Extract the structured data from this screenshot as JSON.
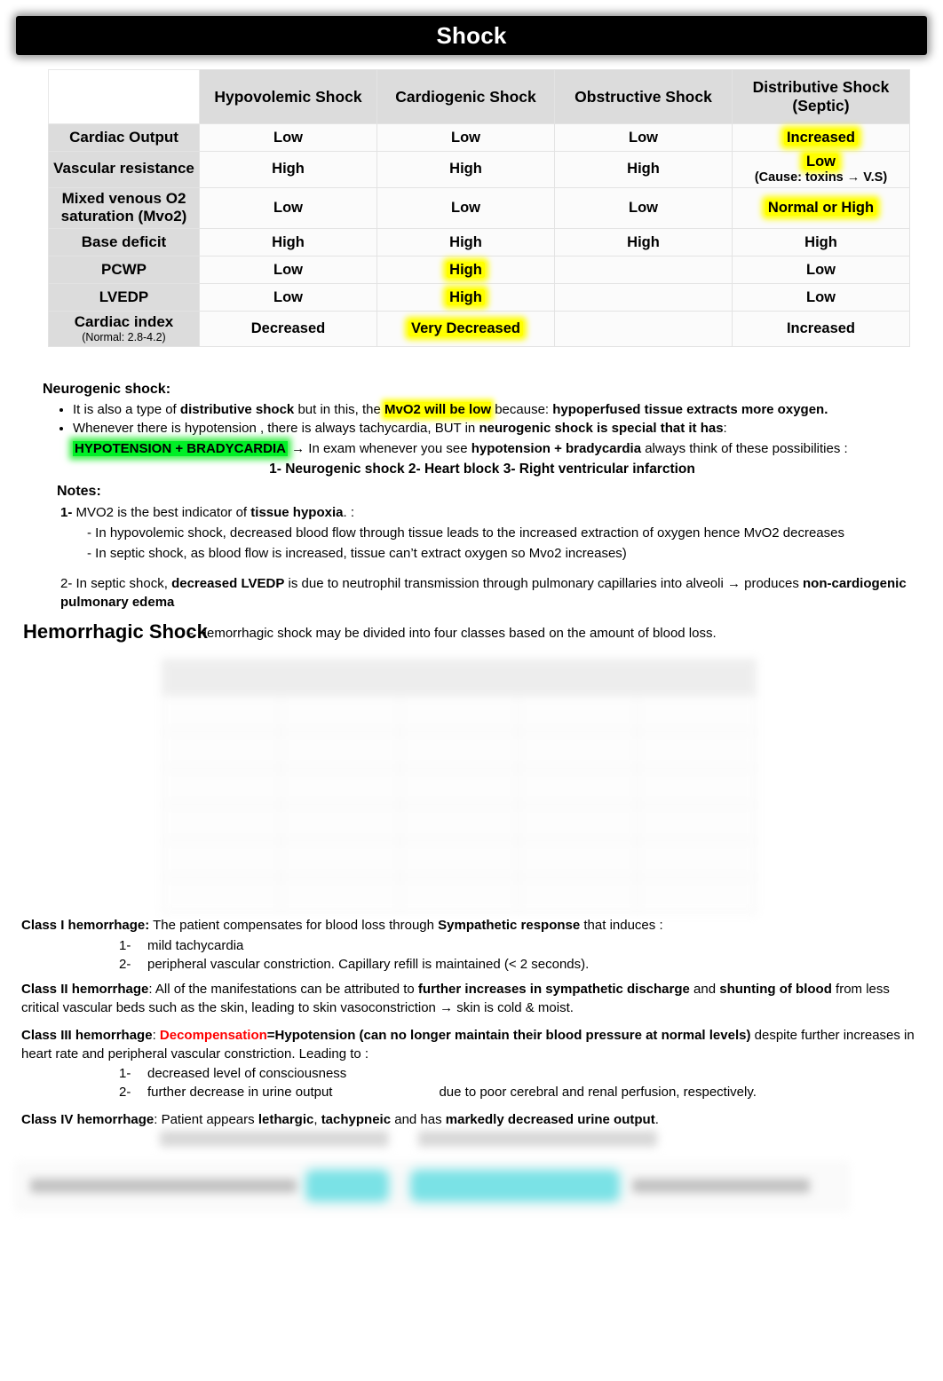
{
  "banner": {
    "title": "Shock"
  },
  "colors": {
    "highlight_yellow": "#ffff00",
    "highlight_green": "#00ef26",
    "highlight_cyan": "#22cfd6",
    "accent_red": "#ff0000",
    "banner_bg": "#000000",
    "row_label_bg": "#dcdcdc"
  },
  "comparison_table": {
    "corner_label": "",
    "columns": [
      "Hypovolemic Shock",
      "Cardiogenic Shock",
      "Obstructive Shock",
      "Distributive Shock (Septic)"
    ],
    "column_lines": [
      [
        "Hypovolemic Shock"
      ],
      [
        "Cardiogenic Shock"
      ],
      [
        "Obstructive Shock"
      ],
      [
        "Distributive Shock",
        "(Septic)"
      ]
    ],
    "rows": [
      {
        "label": "Cardiac Output",
        "label_sub": "",
        "cells": [
          {
            "text": "Low",
            "highlight": "none"
          },
          {
            "text": "Low",
            "highlight": "none"
          },
          {
            "text": "Low",
            "highlight": "none"
          },
          {
            "text": "Increased",
            "highlight": "yellow"
          }
        ]
      },
      {
        "label": "Vascular resistance",
        "label_sub": "",
        "cells": [
          {
            "text": "High",
            "highlight": "none"
          },
          {
            "text": "High",
            "highlight": "none"
          },
          {
            "text": "High",
            "highlight": "none"
          },
          {
            "text": "Low",
            "highlight": "yellow",
            "note": "(Cause: toxins → V.S)"
          }
        ]
      },
      {
        "label": "Mixed venous O2 saturation (Mvo2)",
        "label_sub": "",
        "cells": [
          {
            "text": "Low",
            "highlight": "none"
          },
          {
            "text": "Low",
            "highlight": "none"
          },
          {
            "text": "Low",
            "highlight": "none"
          },
          {
            "text": "Normal or High",
            "highlight": "yellow"
          }
        ]
      },
      {
        "label": "Base deficit",
        "label_sub": "",
        "cells": [
          {
            "text": "High",
            "highlight": "none"
          },
          {
            "text": "High",
            "highlight": "none"
          },
          {
            "text": "High",
            "highlight": "none"
          },
          {
            "text": "High",
            "highlight": "none"
          }
        ]
      },
      {
        "label": "PCWP",
        "label_sub": "",
        "cells": [
          {
            "text": "Low",
            "highlight": "none"
          },
          {
            "text": "High",
            "highlight": "yellow"
          },
          {
            "text": "",
            "highlight": "none"
          },
          {
            "text": "Low",
            "highlight": "none"
          }
        ]
      },
      {
        "label": "LVEDP",
        "label_sub": "",
        "cells": [
          {
            "text": "Low",
            "highlight": "none"
          },
          {
            "text": "High",
            "highlight": "yellow"
          },
          {
            "text": "",
            "highlight": "none"
          },
          {
            "text": "Low",
            "highlight": "none"
          }
        ]
      },
      {
        "label": "Cardiac index",
        "label_sub": "(Normal: 2.8-4.2)",
        "cells": [
          {
            "text": "Decreased",
            "highlight": "none"
          },
          {
            "text": "Very Decreased",
            "highlight": "yellow"
          },
          {
            "text": "",
            "highlight": "none"
          },
          {
            "text": "Increased",
            "highlight": "none"
          }
        ]
      }
    ]
  },
  "neurogenic": {
    "heading": "Neurogenic shock:",
    "bullet1": {
      "part1": "It is also a type of ",
      "bold1": "distributive shock",
      "part2": " but in this, the ",
      "highlight": "MvO2 will be low",
      "part3": " because: ",
      "bold2": "hypoperfused tissue extracts more oxygen."
    },
    "bullet2": {
      "part1": "Whenever there is hypotension , there is always tachycardia, BUT in ",
      "bold1": "neurogenic shock is special that it has",
      "part2": ":"
    },
    "green_line": {
      "highlight": "HYPOTENSION + BRADYCARDIA",
      "arrow": "→",
      "part1": " In exam whenever you see ",
      "bold1": "hypotension + bradycardia",
      "part2": " always think of these possibilities :"
    },
    "possibilities": "1-  Neurogenic shock    2- Heart block   3- Right ventricular infarction"
  },
  "notes": {
    "heading": "Notes:",
    "note1": {
      "num": "1-",
      "part1": " MVO2 is the best indicator of ",
      "bold1": "tissue hypoxia",
      "part2": ". :"
    },
    "note1_sub1": "- In hypovolemic shock, decreased blood flow through tissue leads to the increased extraction of oxygen hence MvO2 decreases",
    "note1_sub2": "- In septic shock, as blood flow is increased, tissue can’t extract oxygen so Mvo2 increases)",
    "note2": {
      "num": "2-",
      "part1": " In septic shock, ",
      "bold1": "decreased LVEDP",
      "part2": " is due to neutrophil transmission through pulmonary capillaries into alveoli ",
      "arrow": "→",
      "part3": " produces ",
      "bold2": "non-cardiogenic pulmonary edema"
    }
  },
  "hemorrhagic": {
    "heading": "Hemorrhagic Shock",
    "subtitle": "- Hemorrhagic shock may be divided into four classes based on the amount of blood loss.",
    "blurred_table_note": "illegible blurred table image"
  },
  "classes": {
    "class1": {
      "label": "Class I hemorrhage:",
      "text1": " The patient compensates for blood loss through ",
      "bold1": "Sympathetic response",
      "text2": " that induces :",
      "items": [
        {
          "num": "1-",
          "text": "mild tachycardia"
        },
        {
          "num": "2-",
          "text": "peripheral vascular constriction. Capillary refill is maintained (< 2 seconds)."
        }
      ]
    },
    "class2": {
      "label": "Class II hemorrhage",
      "text1": ": All of the manifestations can be attributed to ",
      "bold1": "further increases in sympathetic discharge",
      "text2": " and ",
      "bold2": "shunting of blood",
      "text3": " from less critical vascular beds such as the skin, leading to skin vasoconstriction ",
      "arrow": "→",
      "text4": " skin is cold & moist."
    },
    "class3": {
      "label": "Class III hemorrhage",
      "text1": ":  ",
      "red1": "Decompensation",
      "text2": "=Hypotension ",
      "bold1": "(can no longer maintain their blood pressure at normal levels)",
      "text3": " despite further increases in heart rate and peripheral vascular constriction. Leading to :",
      "items": [
        {
          "num": "1-",
          "text": "decreased level of consciousness"
        },
        {
          "num": "2-",
          "text": "further decrease in urine output",
          "tail": "due to poor cerebral and renal perfusion, respectively."
        }
      ]
    },
    "class4": {
      "label": "Class IV hemorrhage",
      "text1": ": Patient appears ",
      "bold1": "lethargic",
      "text2": ", ",
      "bold2": "tachypneic",
      "text3": " and has ",
      "bold3": "markedly decreased urine output",
      "text4": "."
    }
  }
}
